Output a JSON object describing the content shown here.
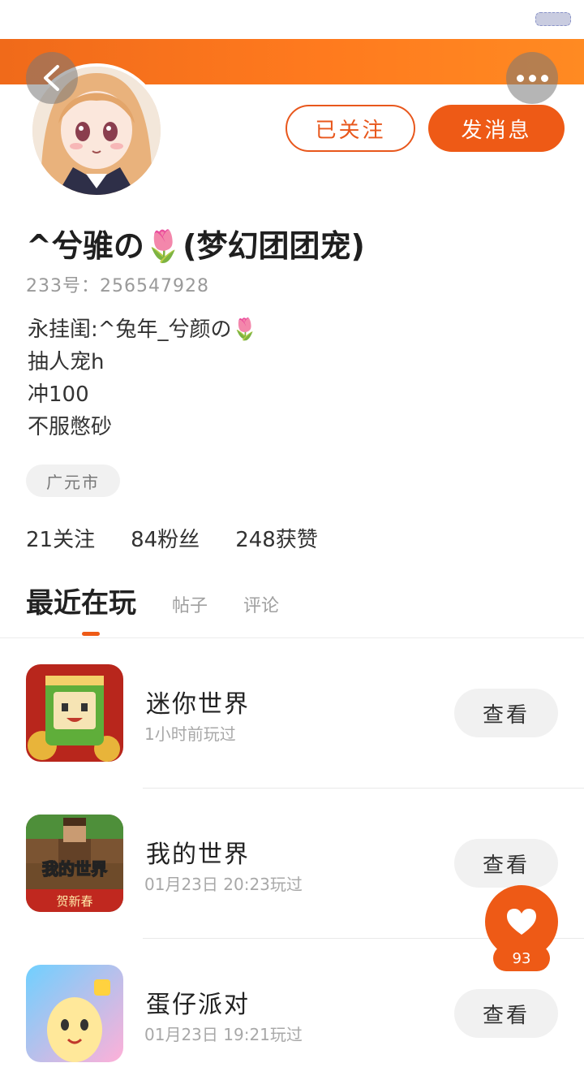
{
  "header": {
    "back_icon": "back-arrow-icon",
    "more_icon": "more-dots-icon"
  },
  "profile": {
    "followed_label": "已关注",
    "message_label": "发消息",
    "nickname": "^兮骓の🌷(梦幻团团宠)",
    "uid": "233号：256547928",
    "bio_lines": [
      "永挂闺:^兔年_兮颜の🌷",
      "抽人宠h",
      "冲100",
      "不服憋砂"
    ],
    "location": "广元市"
  },
  "stats": {
    "following": "21关注",
    "fans": "84粉丝",
    "likes": "248获赞"
  },
  "tabs": [
    {
      "label": "最近在玩",
      "active": true
    },
    {
      "label": "帖子",
      "active": false
    },
    {
      "label": "评论",
      "active": false
    }
  ],
  "games": [
    {
      "name": "迷你世界",
      "time": "1小时前玩过",
      "action": "查看"
    },
    {
      "name": "我的世界",
      "time": "01月23日 20:23玩过",
      "action": "查看",
      "icon_text": "我的世界",
      "icon_banner": "贺新春"
    },
    {
      "name": "蛋仔派对",
      "time": "01月23日 19:21玩过",
      "action": "查看"
    }
  ],
  "like_fab": {
    "icon": "heart-icon",
    "count": "93"
  },
  "colors": {
    "accent": "#ee5a16",
    "banner_start": "#f06a1a",
    "banner_end": "#ff8a22"
  }
}
